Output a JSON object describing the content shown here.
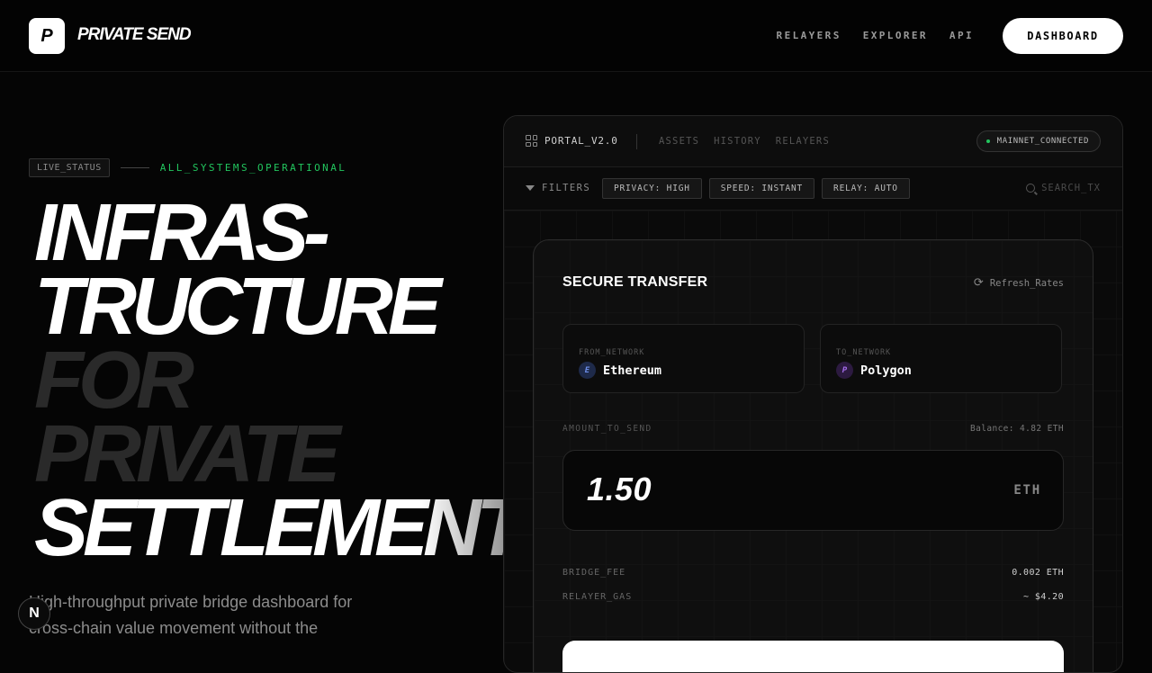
{
  "nav": {
    "logo_letter": "P",
    "brand": "PRIVATE SEND",
    "links": [
      "RELAYERS",
      "EXPLORER",
      "API"
    ],
    "dashboard_label": "DASHBOARD"
  },
  "hero": {
    "status_badge": "LIVE_STATUS",
    "status_text": "ALL_SYSTEMS_OPERATIONAL",
    "title_lines": [
      "INFRAS-",
      "TRUCTURE",
      "FOR",
      "PRIVATE",
      "SETTLEMENT."
    ],
    "subtitle": "High-throughput private bridge dashboard for cross-chain value movement without the",
    "corner_button": "N"
  },
  "portal": {
    "title": "PORTAL_V2.0",
    "tabs": [
      "ASSETS",
      "HISTORY",
      "RELAYERS"
    ],
    "network_status": "MAINNET_CONNECTED",
    "filters_label": "FILTERS",
    "chips": [
      "PRIVACY: HIGH",
      "SPEED: INSTANT",
      "RELAY: AUTO"
    ],
    "search_placeholder": "SEARCH_TX"
  },
  "transfer": {
    "title": "SECURE TRANSFER",
    "refresh_label": "Refresh_Rates",
    "from_label": "FROM_NETWORK",
    "from_value": "Ethereum",
    "from_icon_letter": "E",
    "to_label": "TO_NETWORK",
    "to_value": "Polygon",
    "to_icon_letter": "P",
    "amount_label": "AMOUNT_TO_SEND",
    "balance": "Balance: 4.82 ETH",
    "amount": "1.50",
    "amount_unit": "ETH",
    "fees": [
      {
        "label": "BRIDGE_FEE",
        "value": "0.002 ETH"
      },
      {
        "label": "RELAYER_GAS",
        "value": "~ $4.20"
      }
    ]
  },
  "colors": {
    "accent_green": "#22c55e",
    "ethereum": "#6d8ee8",
    "polygon": "#a26be8"
  }
}
